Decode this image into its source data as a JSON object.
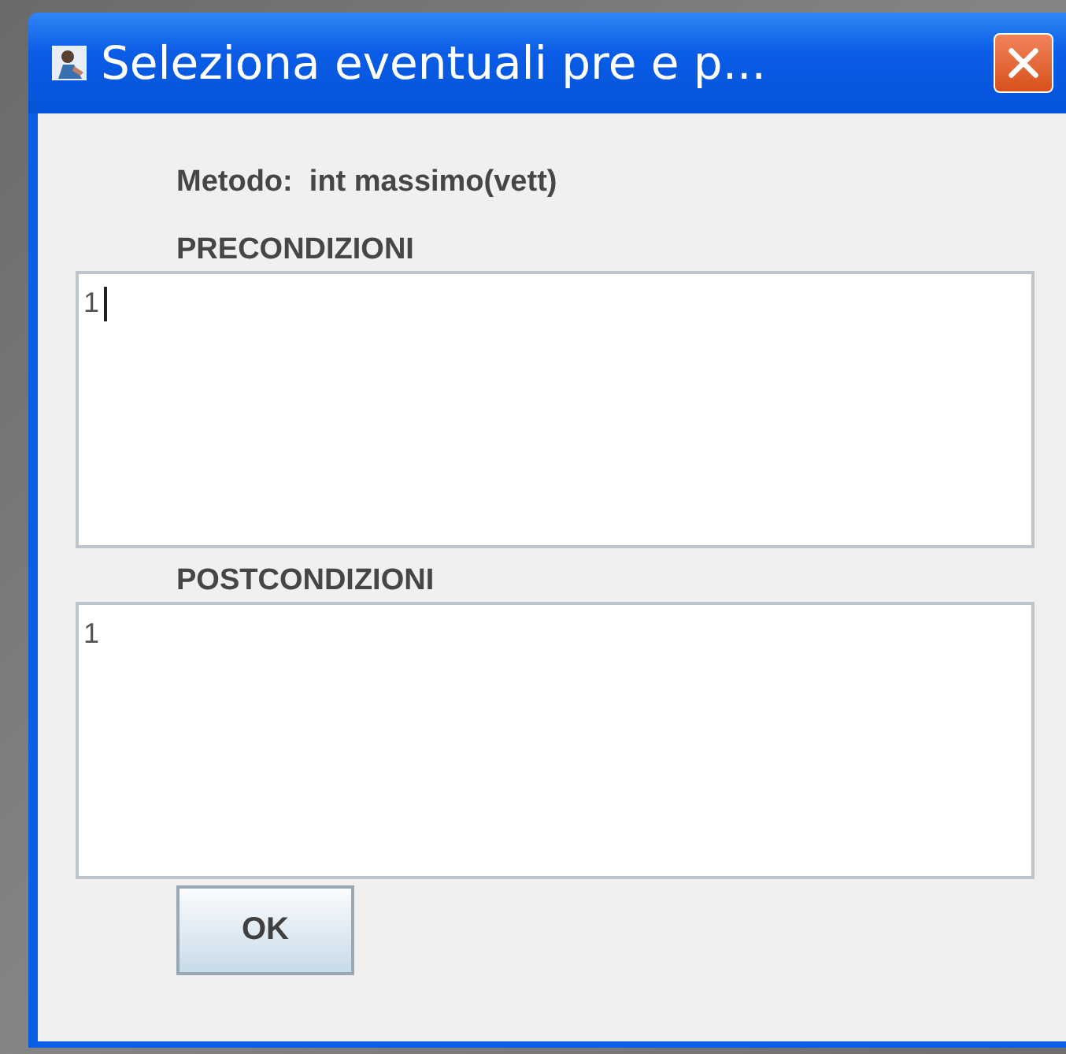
{
  "window": {
    "title": "Seleziona eventuali pre e p..."
  },
  "method_label": "Metodo:  int massimo(vett)",
  "sections": [
    {
      "label": "PRECONDIZIONI",
      "line_number": "1",
      "focused": true
    },
    {
      "label": "POSTCONDIZIONI",
      "line_number": "1",
      "focused": false
    }
  ],
  "buttons": [
    "OK"
  ]
}
